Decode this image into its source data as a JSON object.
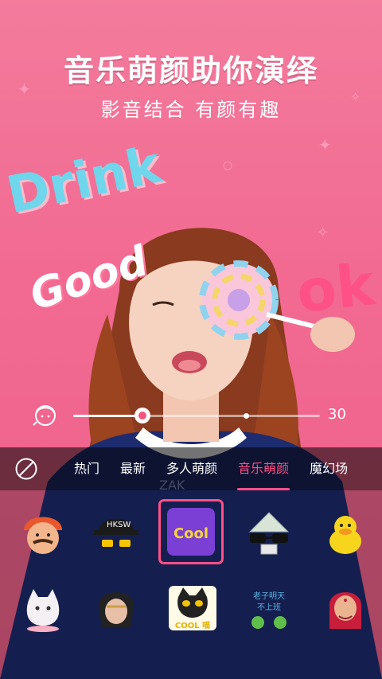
{
  "promo": {
    "headline": "音乐萌颜助你演绎",
    "subline": "影音结合  有颜有趣",
    "deco_drink": "Drink",
    "deco_good": "Good",
    "deco_ok": "ok"
  },
  "beauty_slider": {
    "icon": "face-beauty-icon",
    "value": "30",
    "level_fraction": 0.28
  },
  "tabs": {
    "none_icon": "no-effect-icon",
    "items": [
      {
        "label": "热门",
        "active": false
      },
      {
        "label": "最新",
        "active": false
      },
      {
        "label": "多人萌颜",
        "active": false
      },
      {
        "label": "音乐萌颜",
        "active": true
      },
      {
        "label": "魔幻场",
        "active": false
      }
    ]
  },
  "stickers": [
    {
      "name": "turban-man-sticker",
      "selected": false
    },
    {
      "name": "hiphop-cap-sticker",
      "selected": false
    },
    {
      "name": "cool-sticker",
      "selected": true,
      "text": "Cool"
    },
    {
      "name": "money-glasses-sticker",
      "selected": false
    },
    {
      "name": "duck-sticker",
      "selected": false
    },
    {
      "name": "cat-ghost-sticker",
      "selected": false
    },
    {
      "name": "punk-girl-sticker",
      "selected": false
    },
    {
      "name": "cool-cat-sticker",
      "selected": false,
      "text": "COOL 喵"
    },
    {
      "name": "frog-text-sticker",
      "selected": false,
      "text": "老子明天不上班"
    },
    {
      "name": "indian-girl-sticker",
      "selected": false
    }
  ],
  "colors": {
    "accent": "#ff4f86",
    "background": "#f26a92"
  }
}
